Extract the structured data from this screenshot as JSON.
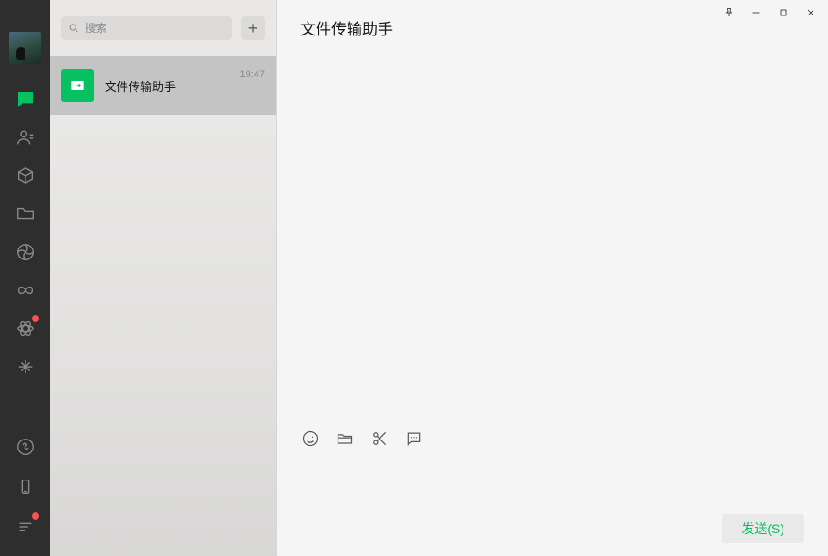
{
  "nav": {
    "icons": {
      "chat": "chat-bubble-icon",
      "contacts": "contacts-icon",
      "collection": "cube-icon",
      "files": "folder-icon",
      "moments": "aperture-icon",
      "channels": "butterfly-icon",
      "discover": "atom-icon",
      "topstories": "sparkle-icon",
      "miniprogram": "miniprogram-icon",
      "phone": "phone-icon",
      "menu": "menu-icon"
    }
  },
  "search": {
    "placeholder": "搜索",
    "add_label": "+"
  },
  "conversations": [
    {
      "title": "文件传输助手",
      "time": "19:47",
      "selected": true
    }
  ],
  "chat": {
    "header_title": "文件传输助手",
    "send_label": "发送(S)",
    "message_value": ""
  },
  "colors": {
    "accent": "#07c160",
    "nav_bg": "#2e2e2e",
    "badge": "#fa5151"
  }
}
